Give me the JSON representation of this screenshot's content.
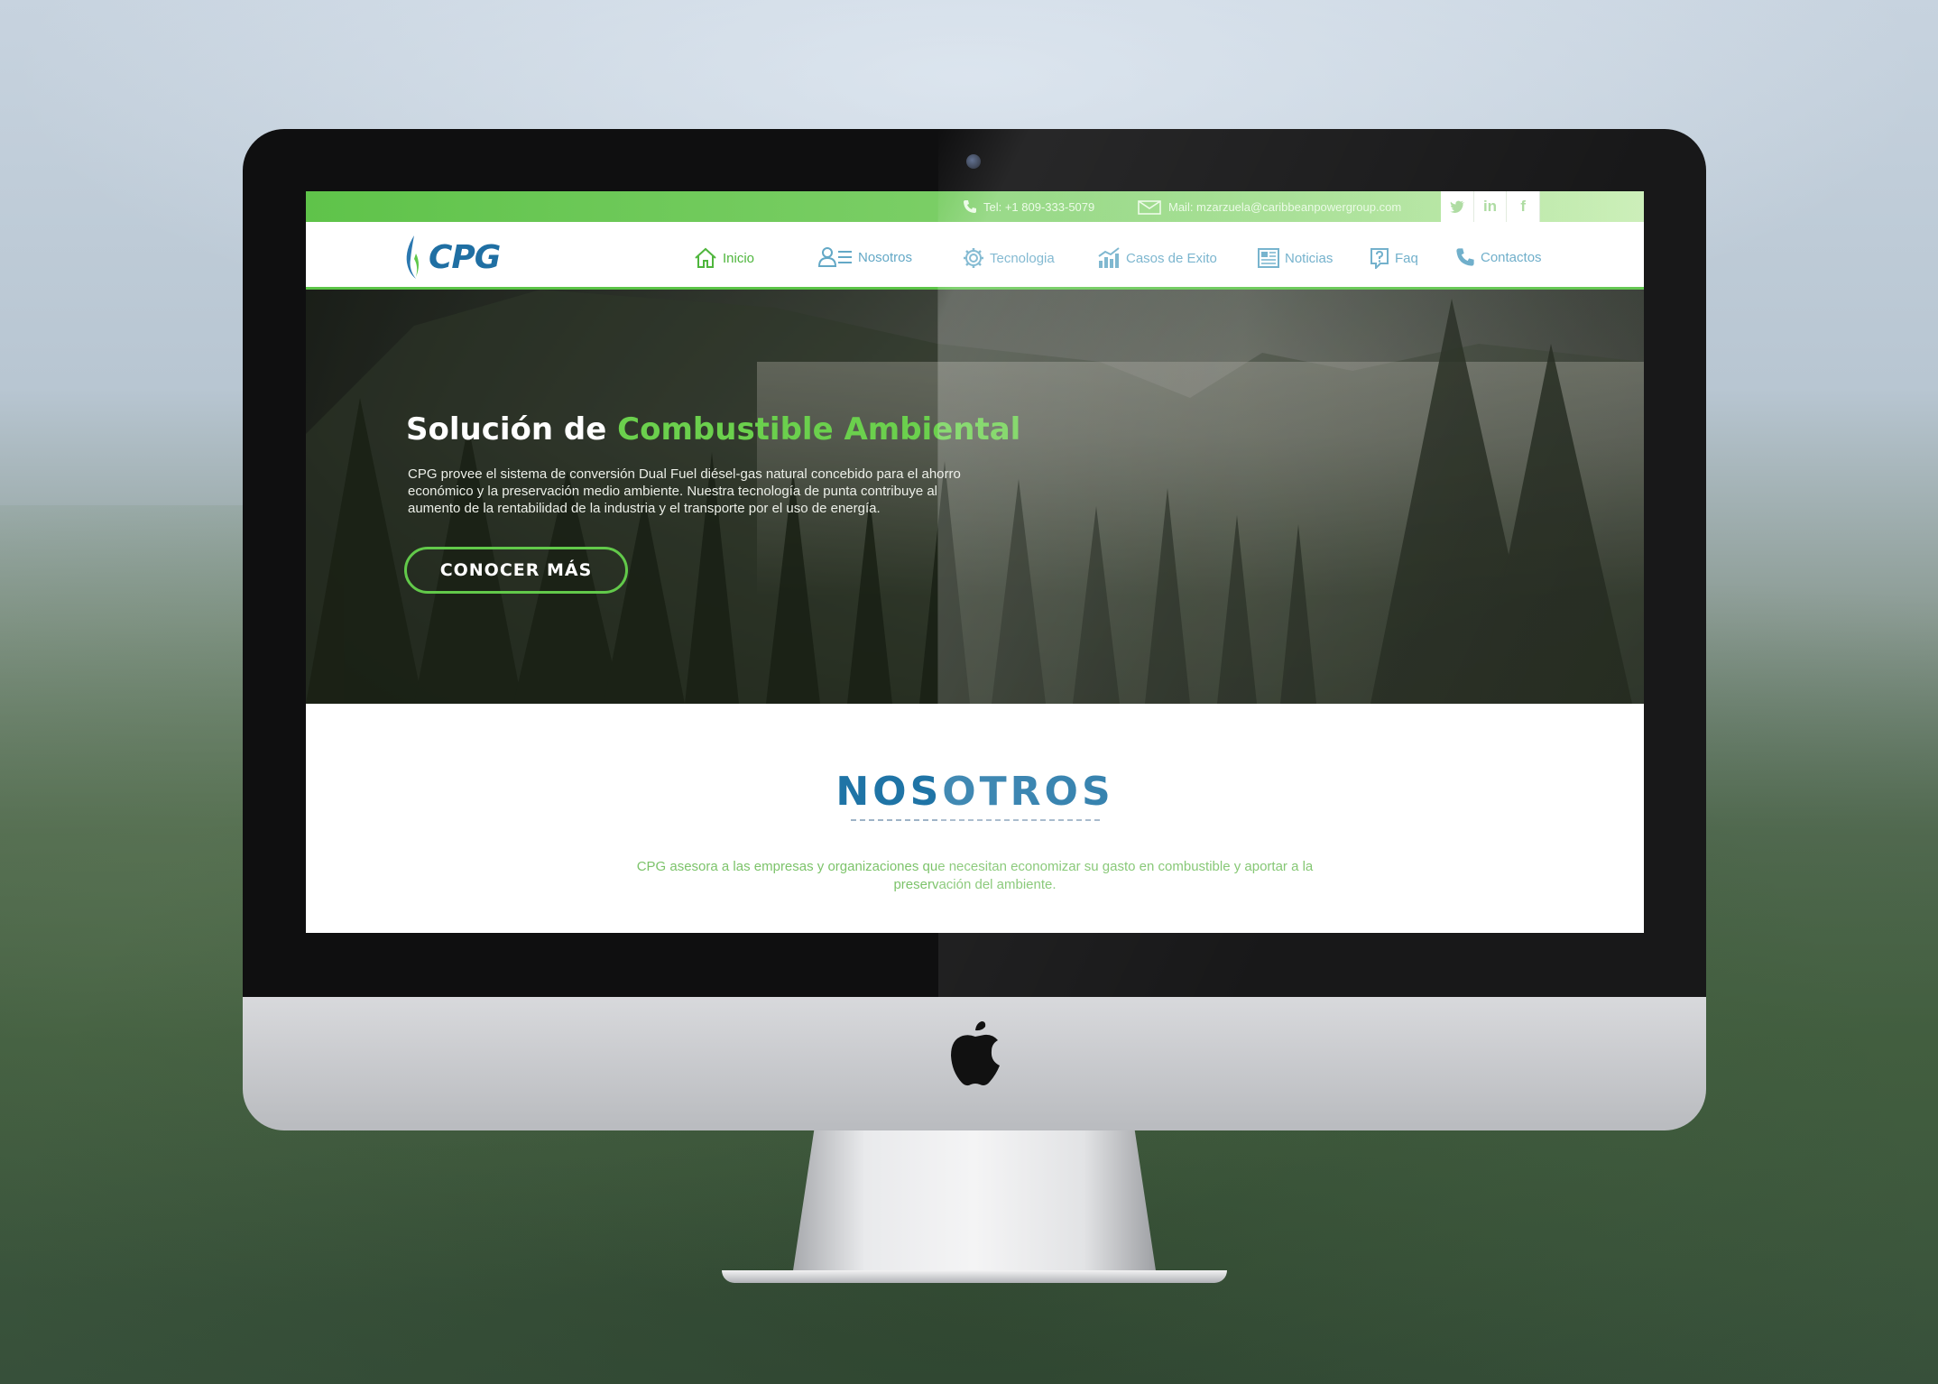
{
  "topbar": {
    "tel": "Tel:  +1 809-333-5079",
    "mail": "Mail:  mzarzuela@caribbeanpowergroup.com",
    "social": [
      "twitter-icon",
      "linkedin-icon",
      "facebook-icon"
    ]
  },
  "brand": {
    "logo_text": "CPG"
  },
  "nav": {
    "items": [
      {
        "label": "Inicio",
        "icon": "home-icon",
        "active": true
      },
      {
        "label": "Nosotros",
        "icon": "users-icon"
      },
      {
        "label": "Tecnologia",
        "icon": "gear-icon"
      },
      {
        "label": "Casos de Exito",
        "icon": "chart-icon"
      },
      {
        "label": "Noticias",
        "icon": "newspaper-icon"
      },
      {
        "label": "Faq",
        "icon": "question-icon"
      },
      {
        "label": "Contactos",
        "icon": "phone-icon"
      }
    ]
  },
  "hero": {
    "title_white": "Solución de ",
    "title_green": "Combustible Ambiental",
    "description": "CPG provee el sistema de conversión Dual Fuel diésel-gas natural concebido para el ahorro económico y la preservación medio ambiente. Nuestra tecnología de punta contribuye al aumento de la rentabilidad de la industria y el transporte por el uso de energía.",
    "cta": "CONOCER MÁS"
  },
  "about": {
    "title": "NOSOTROS",
    "text": "CPG asesora a las empresas y organizaciones que necesitan economizar su gasto en combustible y aportar a la preservación del ambiente."
  },
  "colors": {
    "accent_green": "#5bc447",
    "brand_blue": "#1f74a6",
    "link_blue": "#63a8c6"
  }
}
